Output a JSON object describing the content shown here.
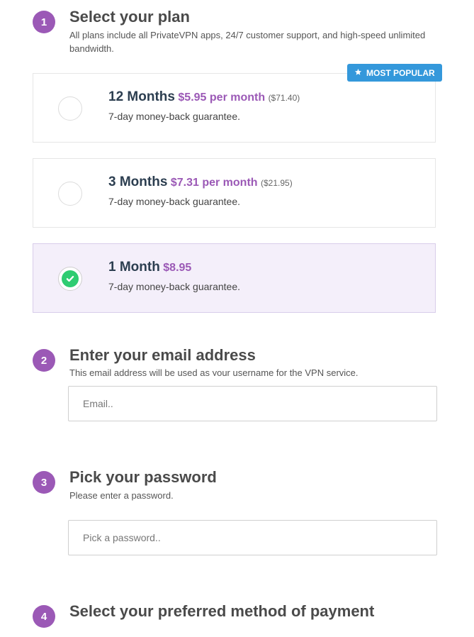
{
  "steps": [
    {
      "number": "1",
      "title": "Select your plan",
      "subtitle": "All plans include all PrivateVPN apps, 24/7 customer support, and high-speed unlimited bandwidth."
    },
    {
      "number": "2",
      "title": "Enter your email address",
      "subtitle": "This email address will be used as your username for the VPN service."
    },
    {
      "number": "3",
      "title": "Pick your password",
      "subtitle": "Please enter a password."
    },
    {
      "number": "4",
      "title": "Select your preferred method of payment"
    }
  ],
  "badge": {
    "label": "MOST POPULAR",
    "icon": "star-icon"
  },
  "plans": [
    {
      "name": "12 Months",
      "price": "$5.95 per month",
      "total": "($71.40)",
      "guarantee": "7-day money-back guarantee.",
      "selected": false
    },
    {
      "name": "3 Months",
      "price": "$7.31 per month",
      "total": "($21.95)",
      "guarantee": "7-day money-back guarantee.",
      "selected": false
    },
    {
      "name": "1 Month",
      "price": "$8.95",
      "total": "",
      "guarantee": "7-day money-back guarantee.",
      "selected": true
    }
  ],
  "email": {
    "placeholder": "Email.."
  },
  "password": {
    "placeholder": "Pick a password.."
  },
  "colors": {
    "accent": "#9b59b6",
    "badge": "#3498db",
    "check": "#2ecc71"
  }
}
